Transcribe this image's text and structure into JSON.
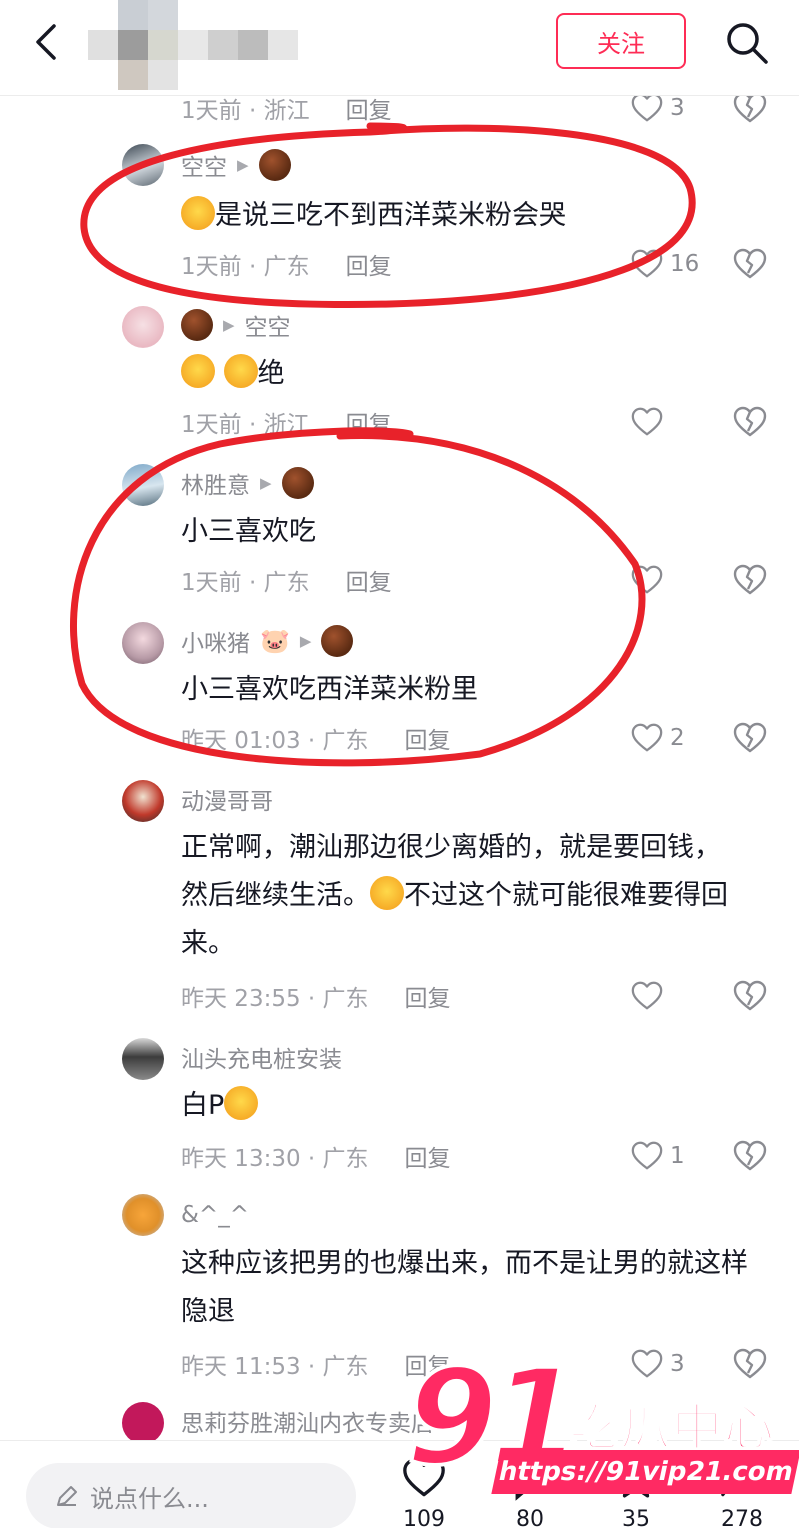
{
  "header": {
    "follow_label": "关注"
  },
  "top_meta": {
    "time_loc": "1天前 · 浙江",
    "reply": "回复",
    "likes": "3"
  },
  "comments": [
    {
      "user": "空空",
      "text": "是说三吃不到西洋菜米粉会哭",
      "time_loc": "1天前 · 广东",
      "reply": "回复",
      "likes": "16"
    },
    {
      "user": "空空",
      "text": "绝",
      "time_loc": "1天前 · 浙江",
      "reply": "回复",
      "likes": ""
    },
    {
      "user": "林胜意",
      "text": "小三喜欢吃",
      "time_loc": "1天前 · 广东",
      "reply": "回复",
      "likes": ""
    },
    {
      "user": "小咪猪",
      "text": "小三喜欢吃西洋菜米粉里",
      "time_loc": "昨天 01:03 · 广东",
      "reply": "回复",
      "likes": "2"
    },
    {
      "user": "动漫哥哥",
      "text": "正常啊，潮汕那边很少离婚的，就是要回钱，然后继续生活。",
      "text2": "不过这个就可能很难要得回来。",
      "time_loc": "昨天 23:55 · 广东",
      "reply": "回复",
      "likes": ""
    },
    {
      "user": "汕头充电桩安装",
      "text": "白P",
      "time_loc": "昨天 13:30 · 广东",
      "reply": "回复",
      "likes": "1"
    },
    {
      "user": "&^_^",
      "text": "这种应该把男的也爆出来，而不是让男的就这样隐退",
      "time_loc": "昨天 11:53 · 广东",
      "reply": "回复",
      "likes": "3"
    },
    {
      "user": "思莉芬胜潮汕内衣专卖店"
    }
  ],
  "bottom": {
    "placeholder": "说点什么...",
    "likes": "109",
    "comments": "80",
    "favorites": "35",
    "shares": "278"
  },
  "watermark": {
    "num": "91",
    "name": "吃瓜中心",
    "url": "https://91vip21.com"
  },
  "colors": {
    "accent": "#fe2c55",
    "annotation": "#e8222a",
    "watermark": "#ff2a63"
  }
}
